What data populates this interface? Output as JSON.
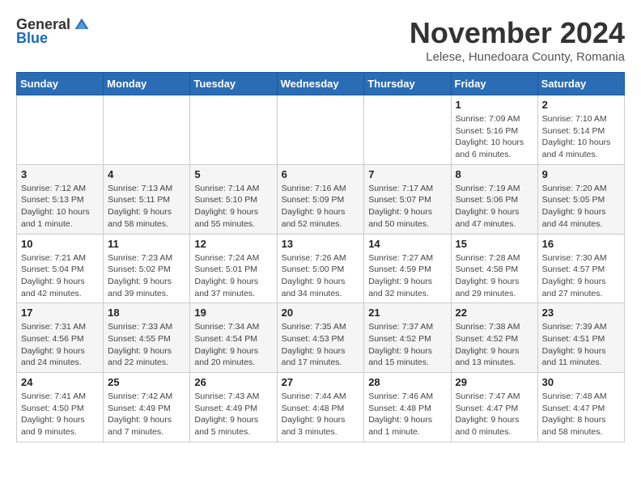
{
  "logo": {
    "general": "General",
    "blue": "Blue"
  },
  "header": {
    "month": "November 2024",
    "location": "Lelese, Hunedoara County, Romania"
  },
  "days_of_week": [
    "Sunday",
    "Monday",
    "Tuesday",
    "Wednesday",
    "Thursday",
    "Friday",
    "Saturday"
  ],
  "weeks": [
    [
      {
        "day": "",
        "info": ""
      },
      {
        "day": "",
        "info": ""
      },
      {
        "day": "",
        "info": ""
      },
      {
        "day": "",
        "info": ""
      },
      {
        "day": "",
        "info": ""
      },
      {
        "day": "1",
        "info": "Sunrise: 7:09 AM\nSunset: 5:16 PM\nDaylight: 10 hours and 6 minutes."
      },
      {
        "day": "2",
        "info": "Sunrise: 7:10 AM\nSunset: 5:14 PM\nDaylight: 10 hours and 4 minutes."
      }
    ],
    [
      {
        "day": "3",
        "info": "Sunrise: 7:12 AM\nSunset: 5:13 PM\nDaylight: 10 hours and 1 minute."
      },
      {
        "day": "4",
        "info": "Sunrise: 7:13 AM\nSunset: 5:11 PM\nDaylight: 9 hours and 58 minutes."
      },
      {
        "day": "5",
        "info": "Sunrise: 7:14 AM\nSunset: 5:10 PM\nDaylight: 9 hours and 55 minutes."
      },
      {
        "day": "6",
        "info": "Sunrise: 7:16 AM\nSunset: 5:09 PM\nDaylight: 9 hours and 52 minutes."
      },
      {
        "day": "7",
        "info": "Sunrise: 7:17 AM\nSunset: 5:07 PM\nDaylight: 9 hours and 50 minutes."
      },
      {
        "day": "8",
        "info": "Sunrise: 7:19 AM\nSunset: 5:06 PM\nDaylight: 9 hours and 47 minutes."
      },
      {
        "day": "9",
        "info": "Sunrise: 7:20 AM\nSunset: 5:05 PM\nDaylight: 9 hours and 44 minutes."
      }
    ],
    [
      {
        "day": "10",
        "info": "Sunrise: 7:21 AM\nSunset: 5:04 PM\nDaylight: 9 hours and 42 minutes."
      },
      {
        "day": "11",
        "info": "Sunrise: 7:23 AM\nSunset: 5:02 PM\nDaylight: 9 hours and 39 minutes."
      },
      {
        "day": "12",
        "info": "Sunrise: 7:24 AM\nSunset: 5:01 PM\nDaylight: 9 hours and 37 minutes."
      },
      {
        "day": "13",
        "info": "Sunrise: 7:26 AM\nSunset: 5:00 PM\nDaylight: 9 hours and 34 minutes."
      },
      {
        "day": "14",
        "info": "Sunrise: 7:27 AM\nSunset: 4:59 PM\nDaylight: 9 hours and 32 minutes."
      },
      {
        "day": "15",
        "info": "Sunrise: 7:28 AM\nSunset: 4:58 PM\nDaylight: 9 hours and 29 minutes."
      },
      {
        "day": "16",
        "info": "Sunrise: 7:30 AM\nSunset: 4:57 PM\nDaylight: 9 hours and 27 minutes."
      }
    ],
    [
      {
        "day": "17",
        "info": "Sunrise: 7:31 AM\nSunset: 4:56 PM\nDaylight: 9 hours and 24 minutes."
      },
      {
        "day": "18",
        "info": "Sunrise: 7:33 AM\nSunset: 4:55 PM\nDaylight: 9 hours and 22 minutes."
      },
      {
        "day": "19",
        "info": "Sunrise: 7:34 AM\nSunset: 4:54 PM\nDaylight: 9 hours and 20 minutes."
      },
      {
        "day": "20",
        "info": "Sunrise: 7:35 AM\nSunset: 4:53 PM\nDaylight: 9 hours and 17 minutes."
      },
      {
        "day": "21",
        "info": "Sunrise: 7:37 AM\nSunset: 4:52 PM\nDaylight: 9 hours and 15 minutes."
      },
      {
        "day": "22",
        "info": "Sunrise: 7:38 AM\nSunset: 4:52 PM\nDaylight: 9 hours and 13 minutes."
      },
      {
        "day": "23",
        "info": "Sunrise: 7:39 AM\nSunset: 4:51 PM\nDaylight: 9 hours and 11 minutes."
      }
    ],
    [
      {
        "day": "24",
        "info": "Sunrise: 7:41 AM\nSunset: 4:50 PM\nDaylight: 9 hours and 9 minutes."
      },
      {
        "day": "25",
        "info": "Sunrise: 7:42 AM\nSunset: 4:49 PM\nDaylight: 9 hours and 7 minutes."
      },
      {
        "day": "26",
        "info": "Sunrise: 7:43 AM\nSunset: 4:49 PM\nDaylight: 9 hours and 5 minutes."
      },
      {
        "day": "27",
        "info": "Sunrise: 7:44 AM\nSunset: 4:48 PM\nDaylight: 9 hours and 3 minutes."
      },
      {
        "day": "28",
        "info": "Sunrise: 7:46 AM\nSunset: 4:48 PM\nDaylight: 9 hours and 1 minute."
      },
      {
        "day": "29",
        "info": "Sunrise: 7:47 AM\nSunset: 4:47 PM\nDaylight: 9 hours and 0 minutes."
      },
      {
        "day": "30",
        "info": "Sunrise: 7:48 AM\nSunset: 4:47 PM\nDaylight: 8 hours and 58 minutes."
      }
    ]
  ]
}
